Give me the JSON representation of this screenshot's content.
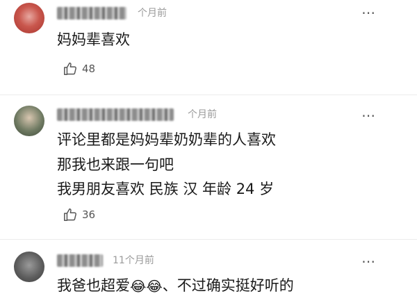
{
  "comments": [
    {
      "username": "●●●● ●●",
      "time": "个月前",
      "lines": [
        "妈妈辈喜欢"
      ],
      "likes": "48"
    },
    {
      "username": "●●●●●●●●●●●",
      "time": "个月前",
      "lines": [
        "评论里都是妈妈辈奶奶辈的人喜欢",
        "那我也来跟一句吧",
        "我男朋友喜欢 民族 汉 年龄 24 岁"
      ],
      "likes": "36"
    },
    {
      "username": "●●●●",
      "time": "11个月前",
      "text_before": "我爸也超爱",
      "emoji": [
        "😂",
        "😂"
      ],
      "text_after": "、不过确实挺好听的"
    }
  ],
  "more_glyph": "⋯",
  "icons": [
    "thumbs-up-icon",
    "more-icon",
    "avatar"
  ]
}
